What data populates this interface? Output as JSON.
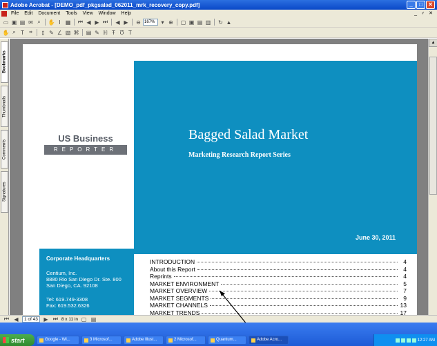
{
  "window": {
    "title": "Adobe Acrobat - [DEMO_pdf_pkgsalad_062011_mrk_recovery_copy.pdf]",
    "controls": [
      "_",
      "□",
      "✕"
    ]
  },
  "menu": [
    "File",
    "Edit",
    "Document",
    "Tools",
    "View",
    "Window",
    "Help"
  ],
  "menu_doc_controls": "_ ♂ ✕",
  "toolbar": {
    "zoom": "167%"
  },
  "side_tabs": [
    "Bookmarks",
    "Thumbnails",
    "Comments",
    "Signatures"
  ],
  "document": {
    "logo_top": "US Business",
    "logo_bottom": "REPORTER",
    "title": "Bagged Salad Market",
    "subtitle": "Marketing Research Report Series",
    "date": "June 30, 2011",
    "hq": {
      "heading": "Corporate Headquarters",
      "company": "Centium, Inc.",
      "street": "8880 Rio San Diego Dr. Ste. 800",
      "city": "San Diego, CA. 92108",
      "tel": "Tel: 619.749-3308",
      "fax": "Fax: 619.532.6326"
    },
    "toc": [
      {
        "label": "INTRODUCTION",
        "page": "4"
      },
      {
        "label": "About this Report",
        "page": "4"
      },
      {
        "label": "Reprints",
        "page": "4"
      },
      {
        "label": "MARKET ENVIRONMENT",
        "page": "5"
      },
      {
        "label": "MARKET OVERVIEW",
        "page": "7"
      },
      {
        "label": "MARKET SEGMENTS",
        "page": "9"
      },
      {
        "label": "MARKET CHANNELS",
        "page": "13"
      },
      {
        "label": "MARKET TRENDS",
        "page": "17"
      }
    ]
  },
  "statusbar": {
    "page": "1 of 43",
    "size": "8 x 11 in"
  },
  "taskbar": {
    "start": "start",
    "tasks": [
      "Google - Wi...",
      "3 Microsof...",
      "Adobe Illust...",
      "2 Microsof...",
      "Quantum...",
      "Adobe Acro..."
    ],
    "clock": "12:27 AM"
  }
}
